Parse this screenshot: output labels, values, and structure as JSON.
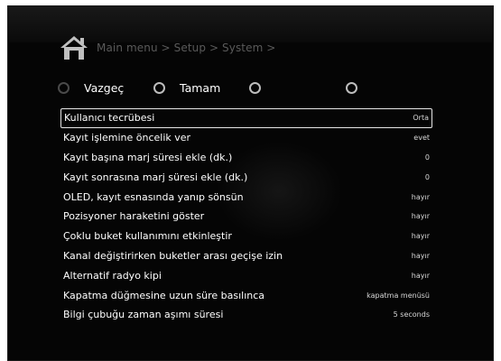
{
  "header": {
    "breadcrumb": "Main menu > Setup > System >",
    "icon": "home-icon"
  },
  "buttons": [
    {
      "label": "Vazgeç"
    },
    {
      "label": "Tamam"
    },
    {
      "label": ""
    },
    {
      "label": ""
    }
  ],
  "settings": [
    {
      "label": "Kullanıcı tecrübesi",
      "value": "Orta"
    },
    {
      "label": "Kayıt işlemine öncelik ver",
      "value": "evet"
    },
    {
      "label": "Kayıt başına marj süresi ekle (dk.)",
      "value": "0"
    },
    {
      "label": "Kayıt sonrasına marj süresi ekle (dk.)",
      "value": "0"
    },
    {
      "label": "OLED, kayıt esnasında yanıp sönsün",
      "value": "hayır"
    },
    {
      "label": "Pozisyoner haraketini göster",
      "value": "hayır"
    },
    {
      "label": "Çoklu buket kullanımını etkinleştir",
      "value": "hayır"
    },
    {
      "label": "Kanal değiştirirken buketler arası geçişe izin",
      "value": "hayır"
    },
    {
      "label": "Alternatif radyo kipi",
      "value": "hayır"
    },
    {
      "label": "Kapatma düğmesine uzun süre basılınca",
      "value": "kapatma menüsü"
    },
    {
      "label": "Bilgi çubuğu zaman aşımı süresi",
      "value": "5 seconds"
    }
  ]
}
